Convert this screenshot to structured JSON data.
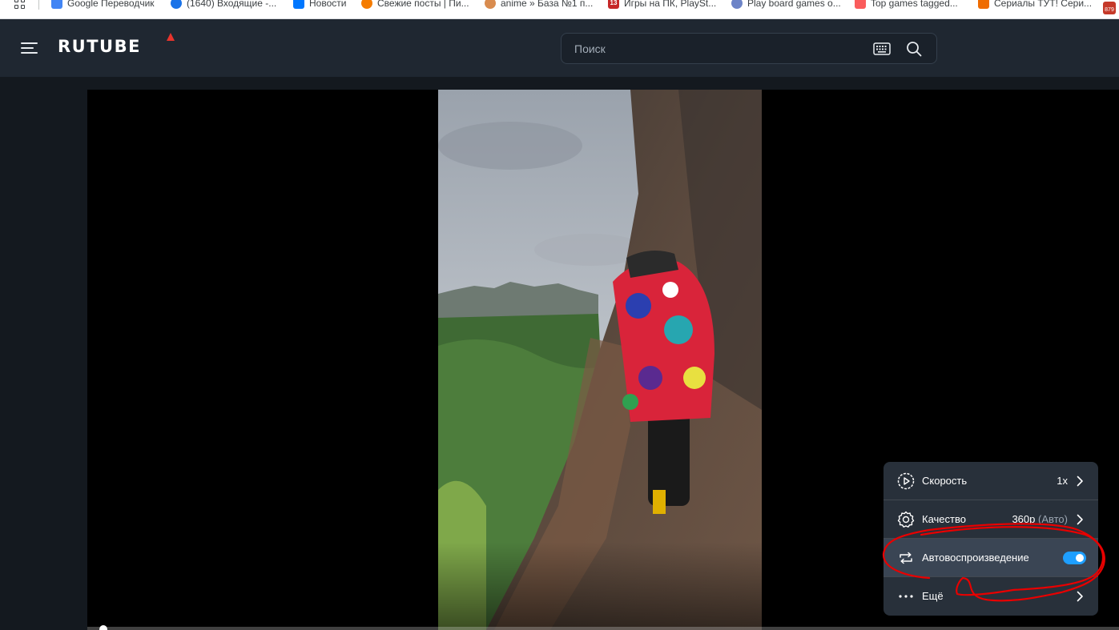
{
  "bookmarks": [
    {
      "label": "Google Переводчик",
      "favicon_color": "#4285f4"
    },
    {
      "label": "(1640) Входящие -...",
      "favicon_color": "#1a73e8"
    },
    {
      "label": "Новости",
      "favicon_color": "#0077ff"
    },
    {
      "label": "Свежие посты | Пи...",
      "favicon_color": "#f57c00"
    },
    {
      "label": "anime » База №1 п...",
      "favicon_color": "#d98c4f"
    },
    {
      "label": "Игры на ПК, PlaySt...",
      "favicon_color": "#c62828",
      "favicon_text": "13"
    },
    {
      "label": "Play board games o...",
      "favicon_color": "#6d84c7"
    },
    {
      "label": "Top games tagged...",
      "favicon_color": "#fa5c5c"
    },
    {
      "label": "Сериалы ТУТ! Сери...",
      "favicon_color": "#ef6c00"
    }
  ],
  "bookmarks_badge": "879",
  "header": {
    "logo": "RUTUBE",
    "search_placeholder": "Поиск",
    "menu_icon": "hamburger-icon",
    "keyboard_icon": "keyboard-icon",
    "search_icon": "search-icon"
  },
  "colors": {
    "header_bg": "#1f2731",
    "page_bg": "#14191f",
    "accent": "#1e9fff",
    "annotation": "#e80000",
    "logo_mark": "#e8342c"
  },
  "player": {
    "progress": 0.01,
    "settings_menu": {
      "speed": {
        "label": "Скорость",
        "value": "1x",
        "icon": "speed-icon"
      },
      "quality": {
        "label": "Качество",
        "value": "360p",
        "value_sub": "(Авто)",
        "icon": "gear-icon"
      },
      "autoplay": {
        "label": "Автовоспроизведение",
        "enabled": true,
        "icon": "repeat-icon"
      },
      "more": {
        "label": "Ещё",
        "icon": "more-dots-icon"
      }
    }
  }
}
